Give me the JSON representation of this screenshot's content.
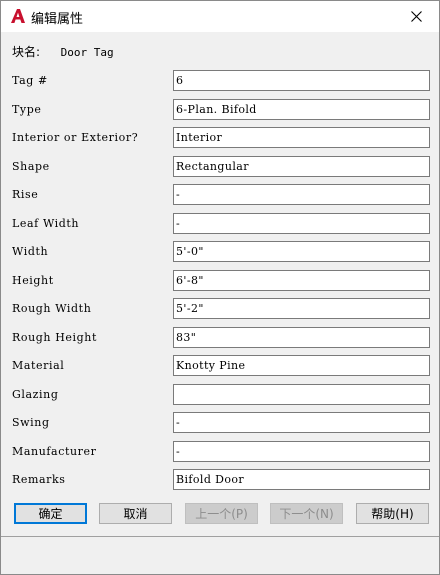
{
  "window": {
    "title": "编辑属性",
    "app_icon": "autocad-a-icon",
    "close_icon": "close-icon"
  },
  "block": {
    "label": "块名:",
    "value": "Door Tag"
  },
  "attributes": [
    {
      "label": "Tag #",
      "value": "6"
    },
    {
      "label": "Type",
      "value": "6-Plan. Bifold"
    },
    {
      "label": "Interior or Exterior?",
      "value": "Interior"
    },
    {
      "label": "Shape",
      "value": "Rectangular"
    },
    {
      "label": "Rise",
      "value": "-"
    },
    {
      "label": "Leaf Width",
      "value": "-"
    },
    {
      "label": "Width",
      "value": "5'-0\""
    },
    {
      "label": "Height",
      "value": "6'-8\""
    },
    {
      "label": "Rough Width",
      "value": "5'-2\""
    },
    {
      "label": "Rough Height",
      "value": "83\""
    },
    {
      "label": "Material",
      "value": "Knotty Pine"
    },
    {
      "label": "Glazing",
      "value": ""
    },
    {
      "label": "Swing",
      "value": "-"
    },
    {
      "label": "Manufacturer",
      "value": "-"
    },
    {
      "label": "Remarks",
      "value": "Bifold Door"
    }
  ],
  "buttons": {
    "ok": "确定",
    "cancel": "取消",
    "prev": "上一个(P)",
    "next": "下一个(N)",
    "help": "帮助(H)"
  },
  "colors": {
    "accent": "#0078d7",
    "app_icon_red": "#c8102e"
  }
}
